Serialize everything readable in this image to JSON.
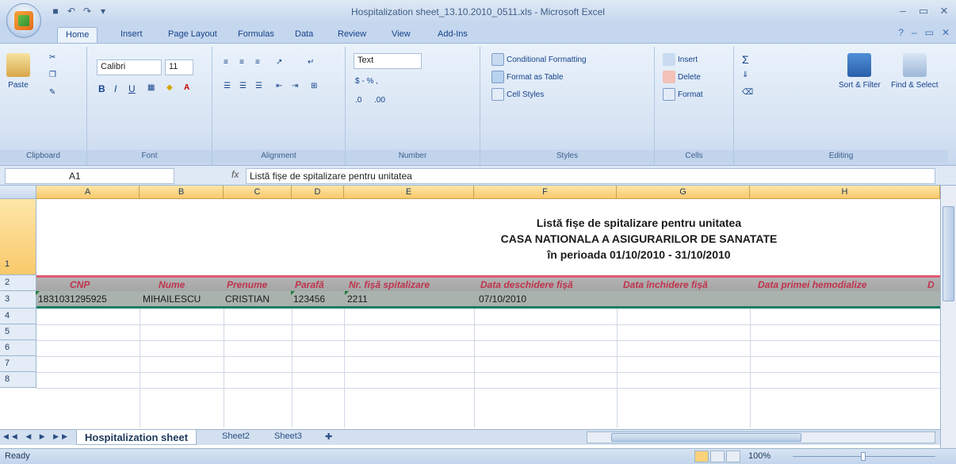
{
  "window": {
    "title": "Hospitalization sheet_13.10.2010_0511.xls - Microsoft Excel",
    "minimize": "–",
    "maximize": "▭",
    "close": "✕"
  },
  "ribbon_tabs": [
    "Home",
    "Insert",
    "Page Layout",
    "Formulas",
    "Data",
    "Review",
    "View",
    "Add-Ins"
  ],
  "ribbon": {
    "clipboard": {
      "paste": "Paste",
      "label": "Clipboard"
    },
    "font": {
      "name": "Calibri",
      "size": "11",
      "label": "Font"
    },
    "alignment": {
      "label": "Alignment"
    },
    "number": {
      "format": "Text",
      "currency": "$ - % ,",
      "label": "Number"
    },
    "styles": {
      "conditional": "Conditional Formatting",
      "format_table": "Format as Table",
      "cell_styles": "Cell Styles",
      "label": "Styles"
    },
    "cells": {
      "insert": "Insert",
      "delete": "Delete",
      "format": "Format",
      "label": "Cells"
    },
    "editing": {
      "sort": "Sort & Filter",
      "find": "Find & Select",
      "label": "Editing"
    }
  },
  "formula_bar": {
    "name_box": "A1",
    "fx": "fx",
    "formula": "Listă fișe de spitalizare pentru unitatea"
  },
  "columns": [
    "A",
    "B",
    "C",
    "D",
    "E",
    "F",
    "G",
    "H"
  ],
  "rows": [
    "1",
    "2",
    "3",
    "4",
    "5",
    "6",
    "7",
    "8"
  ],
  "sheet": {
    "title_lines": [
      "Listă fișe de spitalizare pentru unitatea",
      "CASA NATIONALA A ASIGURARILOR DE SANATATE",
      "în perioada 01/10/2010 - 31/10/2010"
    ],
    "headers": [
      "CNP",
      "Nume",
      "Prenume",
      "Parafă",
      "Nr. fișă spitalizare",
      "Data deschidere fișă",
      "Data închidere fișă",
      "Data primei hemodialize",
      "D"
    ],
    "record": [
      "1831031295925",
      "MIHAILESCU",
      "CRISTIAN",
      "123456",
      "2211",
      "07/10/2010",
      "",
      "",
      ""
    ]
  },
  "sheet_tabs": [
    "Hospitalization sheet",
    "Sheet2",
    "Sheet3"
  ],
  "status": {
    "text": "Ready",
    "zoom": "100%"
  },
  "colors": {
    "header_text": "#c0334d",
    "header_row": "#a8a8a8",
    "data_row": "#aab2ad",
    "accent_line": "#e25a74",
    "bottom_line": "#0d7d62"
  }
}
